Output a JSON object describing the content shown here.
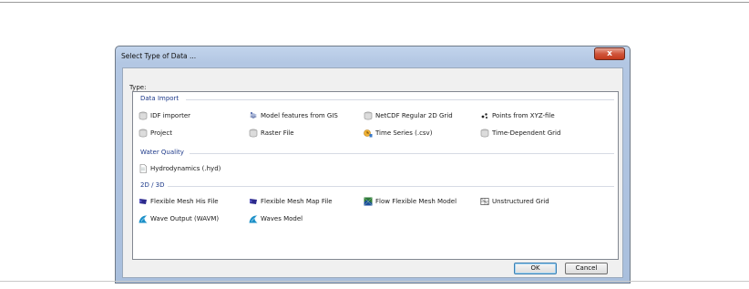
{
  "dialog": {
    "title": "Select Type of Data ...",
    "close_label": "x",
    "type_label": "Type:",
    "ok_label": "OK",
    "cancel_label": "Cancel"
  },
  "groups": [
    {
      "header": "Data Import",
      "items": [
        {
          "label": "IDF importer",
          "icon": "grey-cylinder-icon"
        },
        {
          "label": "Model features from GIS",
          "icon": "gis-layers-icon"
        },
        {
          "label": "NetCDF Regular 2D Grid",
          "icon": "grey-cylinder-icon"
        },
        {
          "label": "Points from XYZ-file",
          "icon": "points-icon"
        },
        {
          "label": "Project",
          "icon": "grey-cylinder-icon"
        },
        {
          "label": "Raster File",
          "icon": "grey-cylinder-icon"
        },
        {
          "label": "Time Series (.csv)",
          "icon": "time-series-icon"
        },
        {
          "label": "Time-Dependent Grid",
          "icon": "grey-cylinder-icon"
        }
      ]
    },
    {
      "header": "Water Quality",
      "items": [
        {
          "label": "Hydrodynamics (.hyd)",
          "icon": "document-icon"
        }
      ]
    },
    {
      "header": "2D / 3D",
      "items": [
        {
          "label": "Flexible Mesh His File",
          "icon": "flag-icon"
        },
        {
          "label": "Flexible Mesh Map File",
          "icon": "flag-icon"
        },
        {
          "label": "Flow Flexible Mesh Model",
          "icon": "flow-model-icon"
        },
        {
          "label": "Unstructured Grid",
          "icon": "grid-icon"
        },
        {
          "label": "Wave Output (WAVM)",
          "icon": "wave-icon"
        },
        {
          "label": "Waves Model",
          "icon": "wave-icon"
        }
      ]
    }
  ],
  "colors": {
    "group_header": "#1e3a8a",
    "title_bar": "#b3c7e3",
    "close_button": "#c8452a"
  }
}
